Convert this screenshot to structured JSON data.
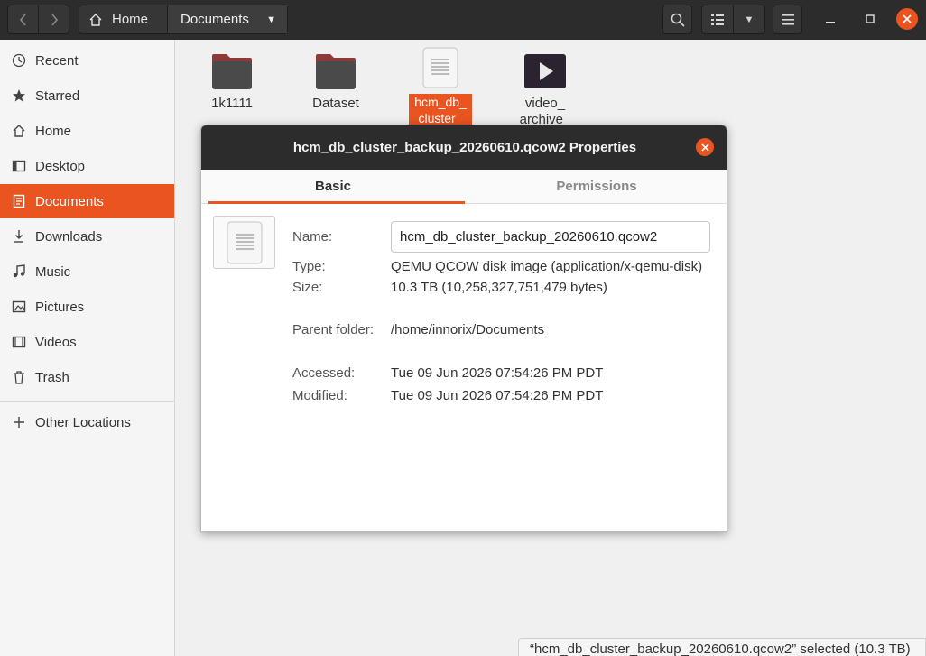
{
  "header": {
    "path": {
      "home": "Home",
      "current": "Documents"
    }
  },
  "sidebar": {
    "items": [
      {
        "label": "Recent",
        "icon": "clock-icon"
      },
      {
        "label": "Starred",
        "icon": "star-icon"
      },
      {
        "label": "Home",
        "icon": "home-icon"
      },
      {
        "label": "Desktop",
        "icon": "desktop-icon"
      },
      {
        "label": "Documents",
        "icon": "document-icon",
        "active": true
      },
      {
        "label": "Downloads",
        "icon": "download-icon"
      },
      {
        "label": "Music",
        "icon": "music-icon"
      },
      {
        "label": "Pictures",
        "icon": "pictures-icon"
      },
      {
        "label": "Videos",
        "icon": "videos-icon"
      },
      {
        "label": "Trash",
        "icon": "trash-icon"
      }
    ],
    "other_locations": "Other Locations"
  },
  "files": [
    {
      "name": "1k1111",
      "type": "folder"
    },
    {
      "name": "Dataset",
      "type": "folder"
    },
    {
      "name_line1": "hcm_db_",
      "name_line2": "cluster_",
      "type": "file",
      "selected": true
    },
    {
      "name_line1": "video_",
      "name_line2": "archive_",
      "type": "video"
    }
  ],
  "statusbar": "“hcm_db_cluster_backup_20260610.qcow2” selected (10.3 TB)",
  "dialog": {
    "title": "hcm_db_cluster_backup_20260610.qcow2 Properties",
    "tabs": [
      "Basic",
      "Permissions"
    ],
    "labels": {
      "name": "Name:",
      "type": "Type:",
      "size": "Size:",
      "parent": "Parent folder:",
      "accessed": "Accessed:",
      "modified": "Modified:"
    },
    "values": {
      "name": "hcm_db_cluster_backup_20260610.qcow2",
      "type": "QEMU QCOW disk image (application/x-qemu-disk)",
      "size": "10.3 TB (10,258,327,751,479 bytes)",
      "parent": "/home/innorix/Documents",
      "accessed": "Tue 09 Jun 2026 07:54:26 PM PDT",
      "modified": "Tue 09 Jun 2026 07:54:26 PM PDT"
    }
  },
  "colors": {
    "accent": "#e95420",
    "headerbar": "#2c2c2c",
    "folder": "#4a4a4a",
    "folder_tab": "#8e3a3a"
  }
}
